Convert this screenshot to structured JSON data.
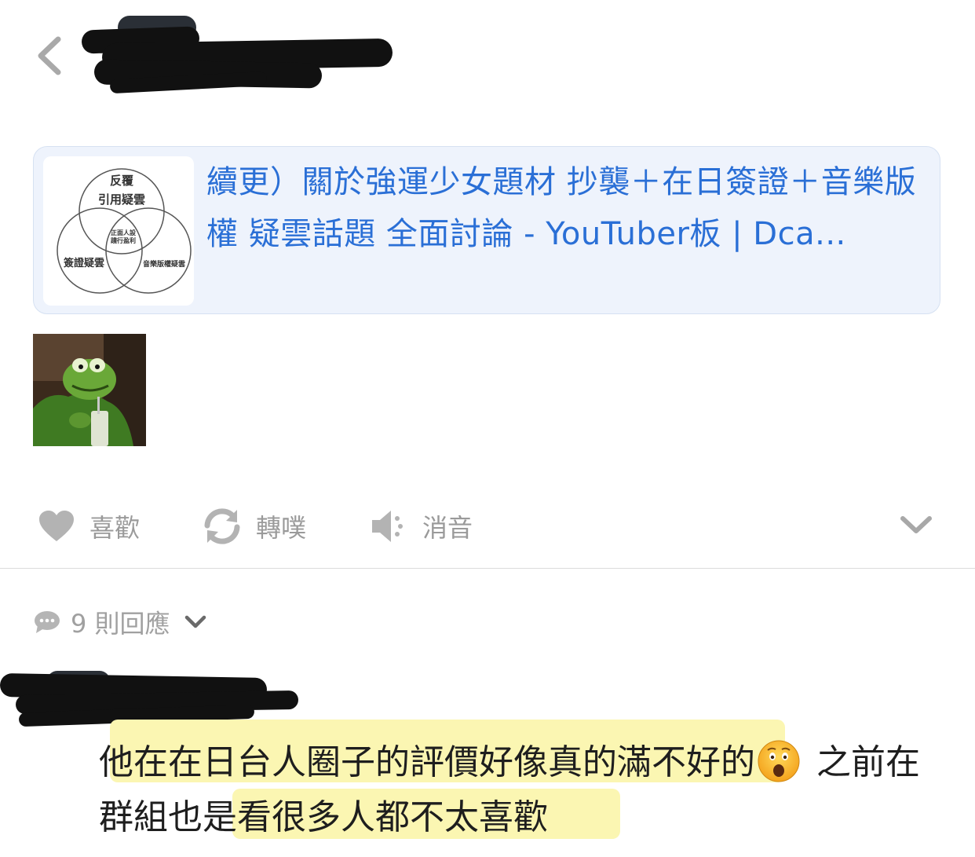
{
  "header": {
    "back_icon": "chevron-left-icon",
    "author_name": "",
    "author_redacted": true
  },
  "link_card": {
    "title": "續更）關於強運少女題材 抄襲＋在日簽證＋音樂版權 疑雲話題 全面討論 - YouTuber板 | Dca...",
    "thumbnail": {
      "top_label_1": "反覆",
      "top_label_2": "引用疑雲",
      "center_label_1": "正面人設",
      "center_label_2": "踐行盈利",
      "left_label": "簽證疑雲",
      "right_label": "音樂版權疑雲"
    },
    "title_color": "#2a6fd6"
  },
  "sticker": {
    "icon": "kermit-sticker-image"
  },
  "actions": {
    "like_label": "喜歡",
    "replurk_label": "轉噗",
    "mute_label": "消音",
    "like_icon": "heart-icon",
    "replurk_icon": "refresh-icon",
    "mute_icon": "speaker-mute-icon",
    "more_icon": "chevron-down-icon"
  },
  "responses": {
    "label": "9 則回應",
    "icon": "speech-bubble-icon"
  },
  "reply": {
    "author_redacted": true,
    "text_part1": "他在在日台人圈子的評價好像真的滿不好的",
    "emoji": "astonished-face-emoji",
    "text_part2": " 之前在群組也是看很多人都不太喜歡",
    "highlight_color": "#fbf6b2"
  }
}
